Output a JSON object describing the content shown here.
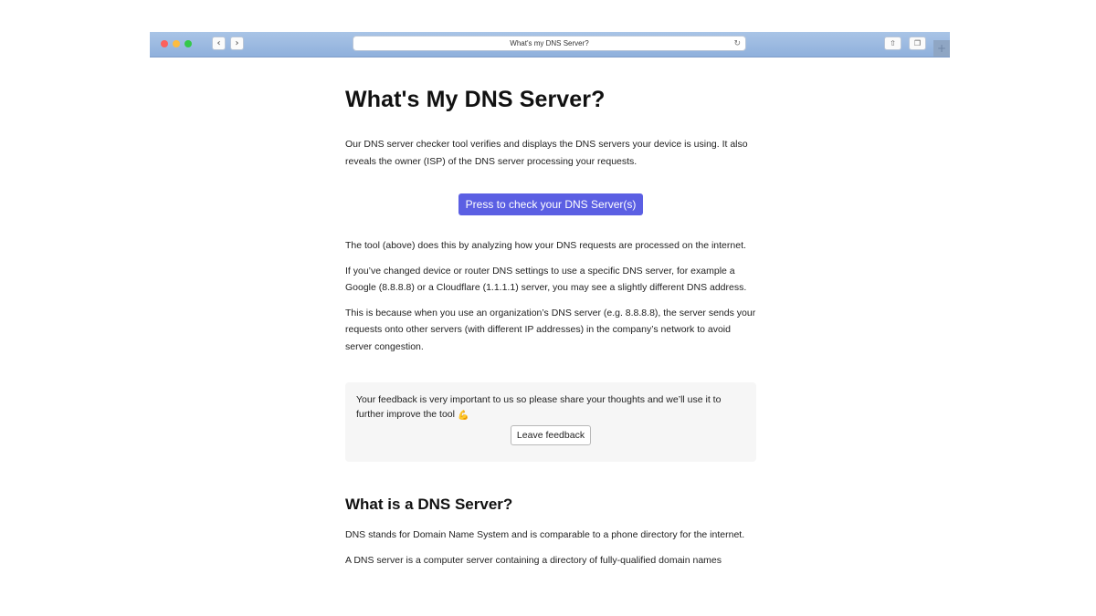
{
  "browser": {
    "url": "What's my DNS Server?",
    "back_icon": "‹",
    "forward_icon": "›",
    "reload_icon": "↻",
    "share_icon": "⇧",
    "tabs_icon": "❐",
    "newtab_icon": "+"
  },
  "page": {
    "title": "What's My DNS Server?",
    "intro": "Our DNS server checker tool verifies and displays the DNS servers your device is using. It also reveals the owner (ISP) of the DNS server processing your requests.",
    "check_button": "Press to check your DNS Server(s)",
    "paragraphs": [
      "The tool (above) does this by analyzing how your DNS requests are processed on the internet.",
      "If you’ve changed device or router DNS settings to use a specific DNS server, for example a Google (8.8.8.8) or a Cloudflare (1.1.1.1) server, you may see a slightly different DNS address.",
      "This is because when you use an organization’s DNS server (e.g. 8.8.8.8), the server sends your requests onto other servers (with different IP addresses) in the company’s network to avoid server congestion."
    ],
    "feedback": {
      "text": "Your feedback is very important to us so please share your thoughts and we’ll use it to further improve the tool",
      "emoji": "💪",
      "button": "Leave feedback"
    },
    "section2_title": "What is a DNS Server?",
    "section2_paragraphs": [
      "DNS stands for Domain Name System and is comparable to a phone directory for the internet.",
      "A DNS server is a computer server containing a directory of fully-qualified domain names"
    ]
  }
}
